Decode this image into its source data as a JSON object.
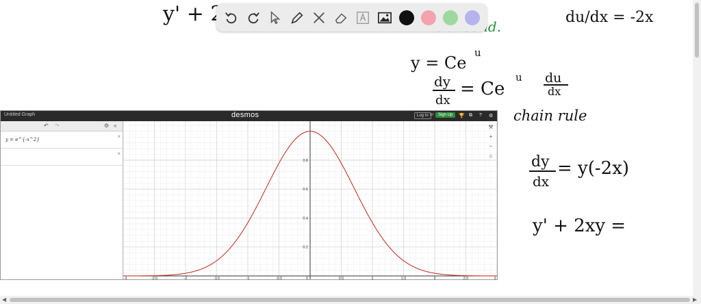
{
  "notes": {
    "top_equation": "y' + 2x(y) = 0   y = Ce",
    "initial_cond": "initial cond.",
    "du_dx": "du/dx = -2x",
    "y_ce_u": "y = Ce",
    "u_exp": "u",
    "dy_dx_num": "dy",
    "dy_dx_den": "dx",
    "ce_u_line": "= Ce",
    "du_num": "du",
    "du_den": "dx",
    "chain_rule": "chain rule",
    "dy_dx_eq": "= y(-2x)",
    "final_line": "y' + 2xy ="
  },
  "toolbar": {
    "colors": [
      "#111111",
      "#f2a3ad",
      "#9fd89f",
      "#b6b2ee"
    ]
  },
  "desmos": {
    "title": "Untitled Graph",
    "logo": "desmos",
    "login": "Log In",
    "or": "or",
    "signup": "Sign Up",
    "expression_1": "y = e^{-x^2}",
    "remove": "×"
  },
  "chart_data": {
    "type": "line",
    "function": "y = e^(-x^2)",
    "xlim": [
      -3,
      3
    ],
    "ylim": [
      0,
      1.06
    ],
    "x_ticks": [
      -3,
      -2.5,
      -2,
      -1.5,
      -1,
      -0.5,
      0,
      0.5,
      1,
      1.5,
      2,
      2.5,
      3
    ],
    "x_tick_labels": [
      "-3",
      "-2.5",
      "-2",
      "-1.5",
      "-1",
      "-0.5",
      "0",
      "0.5",
      "1",
      "1.5",
      "2",
      "2.5",
      "3"
    ],
    "y_ticks": [
      0.2,
      0.4,
      0.6,
      0.8
    ],
    "y_tick_labels": [
      "0.2",
      "0.4",
      "0.6",
      "0.8"
    ],
    "grid": true,
    "line_color": "#c0392b"
  }
}
